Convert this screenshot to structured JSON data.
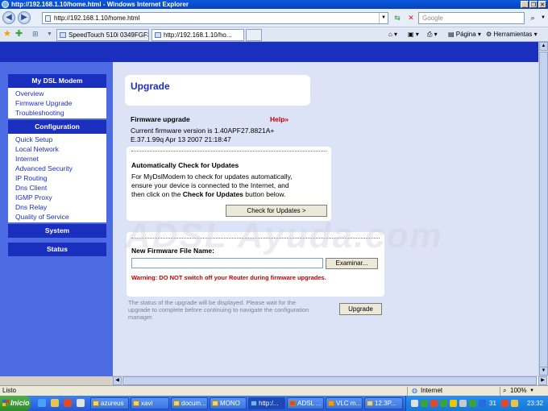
{
  "window": {
    "title": "http://192.168.1.10/home.html - Windows Internet Explorer",
    "url": "http://192.168.1.10/home.html",
    "search_placeholder": "Google"
  },
  "tabs": [
    {
      "label": "SpeedTouch 510i  0349FGF3G"
    },
    {
      "label": "http://192.168.1.10/ho..."
    }
  ],
  "command_bar": {
    "page_label": "Página",
    "tools_label": "Herramientas"
  },
  "sidebar": {
    "sections": [
      {
        "title": "My DSL Modem",
        "items": [
          "Overview",
          "Firmware Upgrade",
          "Troubleshooting"
        ]
      },
      {
        "title": "Configuration",
        "items": [
          "Quick Setup",
          "Local Network",
          "Internet",
          "Advanced Security",
          "IP Routing",
          "Dns Client",
          "IGMP Proxy",
          "Dns Relay",
          "Quality of Service"
        ]
      },
      {
        "title": "System",
        "items": []
      },
      {
        "title": "Status",
        "items": []
      }
    ]
  },
  "main": {
    "page_title": "Upgrade",
    "firmware_heading": "Firmware upgrade",
    "help_label": "Help",
    "current_version_line1": "Current firmware version is 1.40APF27.8821A+",
    "current_version_line2": "E.37.1.99q Apr 13 2007 21:18:47",
    "auto_check_heading": "Automatically Check for Updates",
    "auto_check_line1": "For MyDslModem to check for updates automatically,",
    "auto_check_line2": "ensure your device is connected to the Internet, and",
    "auto_check_line3_pre": "then click on the ",
    "auto_check_line3_bold": "Check for Updates",
    "auto_check_line3_post": " button below.",
    "check_button": "Check for Updates >",
    "new_fw_label": "New Firmware File Name:",
    "browse_button": "Examinar...",
    "warning": "Warning: DO NOT switch off your Router during firmware upgrades.",
    "status_note_line1": "The status of the upgrade will be displayed. Please wait for the",
    "status_note_line2": "upgrade to complete before continuing to navigate the configuration",
    "status_note_line3": "manager.",
    "upgrade_button": "Upgrade",
    "watermark": "ADSL Ayuda.com"
  },
  "statusbar": {
    "status": "Listo",
    "zone": "Internet",
    "zoom": "100%"
  },
  "taskbar": {
    "start_label": "Inicio",
    "tasks": [
      "azureus",
      "xavi",
      "docum...",
      "MONO",
      "http:/...",
      "ADSL ...",
      "VLC m...",
      "12.3P..."
    ],
    "tray_number": "31",
    "clock": "23:32"
  }
}
